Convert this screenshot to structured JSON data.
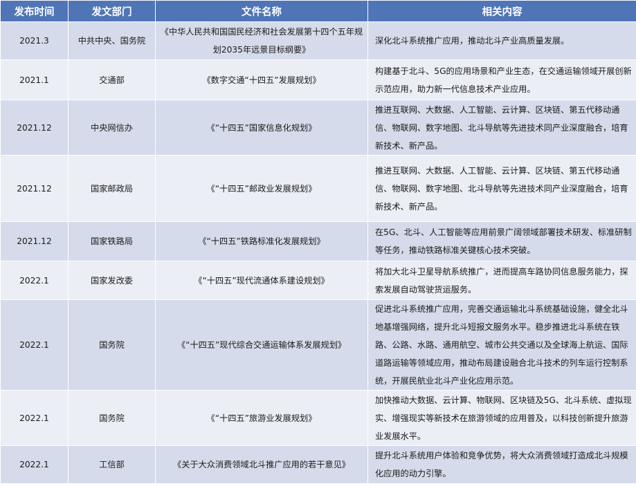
{
  "headers": [
    "发布时间",
    "发文部门",
    "文件名称",
    "相关内容"
  ],
  "rows": [
    {
      "date": "2021.3",
      "dept": "中共中央、国务院",
      "title": "《中华人民共和国国民经济和社会发展第十四个五年规划2035年远景目标纲要》",
      "content": "深化北斗系统推广应用，推动北斗产业高质量发展。"
    },
    {
      "date": "2021.1",
      "dept": "交通部",
      "title": "《数字交通“十四五”发展规划》",
      "content": "构建基于北斗、5G的应用场景和产业生态，在交通运输领域开展创新示范应用，助力新一代信息技术产业应用。"
    },
    {
      "date": "2021.12",
      "dept": "中央网信办",
      "title": "《“十四五”国家信息化规划》",
      "content": "推进互联网、大数据、人工智能、云计算、区块链、第五代移动通信、物联网、数字地图、北斗导航等先进技术同产业深度融合，培育新技术、新产品。"
    },
    {
      "date": "2021.12",
      "dept": "国家邮政局",
      "title": "《“十四五”邮政业发展规划》",
      "content": "推进互联网、大数据、人工智能、云计算、区块链、第五代移动通信、物联网、数字地图、北斗导航等先进技术同产业深度融合，培育新技术、新产品。"
    },
    {
      "date": "2021.12",
      "dept": "国家铁路局",
      "title": "《“十四五”铁路标准化发展规划》",
      "content": "在5G、北斗、人工智能等应用前景广阔领域部署技术研发、标准研制等任务，推动铁路标准关键核心技术突破。"
    },
    {
      "date": "2022.1",
      "dept": "国家发改委",
      "title": "《“十四五”现代流通体系建设规划》",
      "content": "将加大北斗卫星导航系统推广，进而提高车路协同信息服务能力，探索发展自动驾驶货运服务。"
    },
    {
      "date": "2022.1",
      "dept": "国务院",
      "title": "《“十四五”现代综合交通运输体系发展规划》",
      "content": "促进北斗系统推广应用，完善交通运输北斗系统基础设施，健全北斗地基增强网络，提升北斗短报文服务水平。稳步推进北斗系统在铁路、公路、水路、通用航空、城市公共交通以及全球海上航运、国际道路运输等领域应用，推动布局建设融合北斗技术的列车运行控制系统，开展民航业北斗产业化应用示范。"
    },
    {
      "date": "2022.1",
      "dept": "国务院",
      "title": "《“十四五”旅游业发展规划》",
      "content": "加快推动大数据、云计算、物联网、区块链及5G、北斗系统、虚拟现实、增强现实等新技术在旅游领域的应用普及，以科技创新提升旅游业发展水平。"
    },
    {
      "date": "2022.1",
      "dept": "工信部",
      "title": "《关于大众消费领域北斗推广应用的若干意见》",
      "content": "提升北斗系统用户体验和竞争优势，将大众消费领域打造成北斗规模化应用的动力引擎。"
    }
  ]
}
